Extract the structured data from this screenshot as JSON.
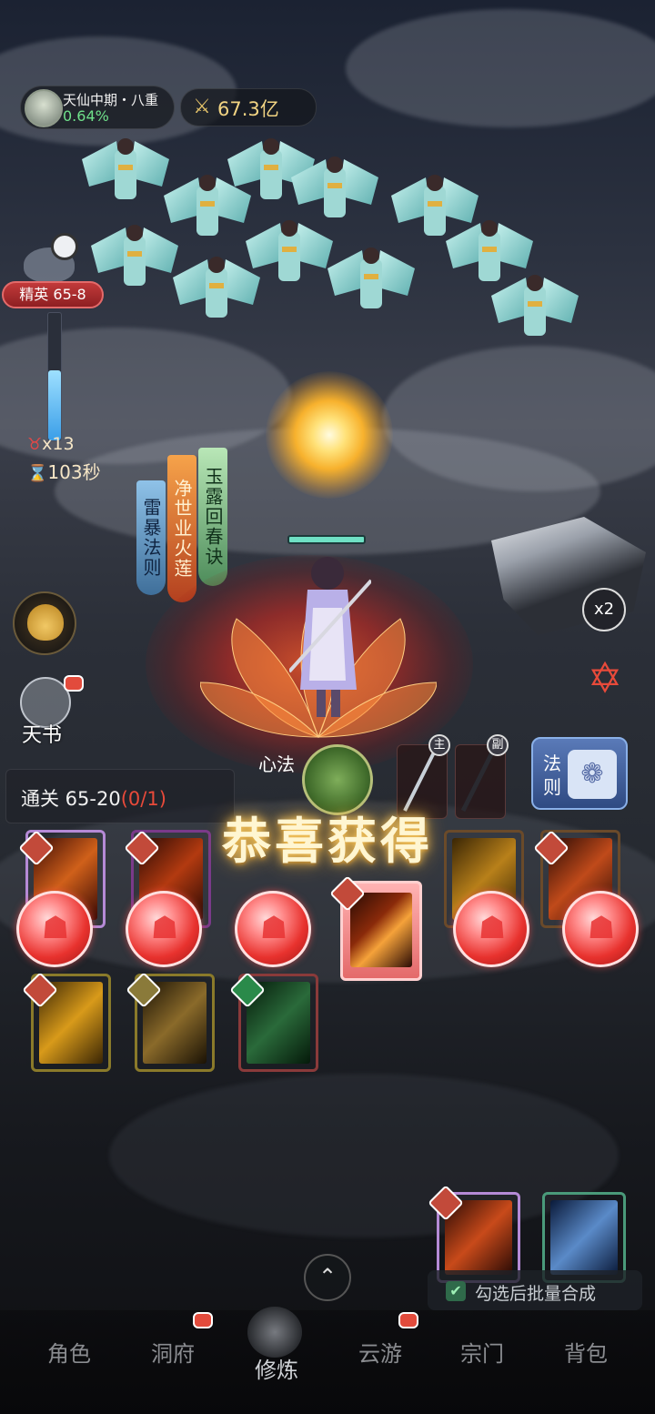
{
  "realm": {
    "title": "天仙中期・八重",
    "percent": "0.64%"
  },
  "power": {
    "value": "67.3亿",
    "icon": "crossed-swords-icon"
  },
  "stage": {
    "label": "精英 65-8",
    "progress": 0.55
  },
  "battle": {
    "kills": "x13",
    "timer": "103秒",
    "skills": [
      "雷暴法则",
      "净世业火莲",
      "玉露回春诀"
    ],
    "speed": "x2"
  },
  "left_buttons": {
    "tianshu": "天书"
  },
  "xinfa": {
    "label": "心法"
  },
  "weapons": {
    "main": "主",
    "sub": "副"
  },
  "fa": {
    "label": "法则"
  },
  "quest": {
    "text": "通关 65-20",
    "progress": "(0/1)"
  },
  "reward": {
    "title": "恭喜获得"
  },
  "batch": {
    "label": "勾选后批量合成"
  },
  "nav": {
    "items": [
      "角色",
      "洞府",
      "修炼",
      "云游",
      "宗门",
      "背包"
    ],
    "active": "修炼"
  },
  "colors": {
    "accent_red": "#e84a3a",
    "gold": "#f2d483",
    "green": "#6fe08a"
  }
}
